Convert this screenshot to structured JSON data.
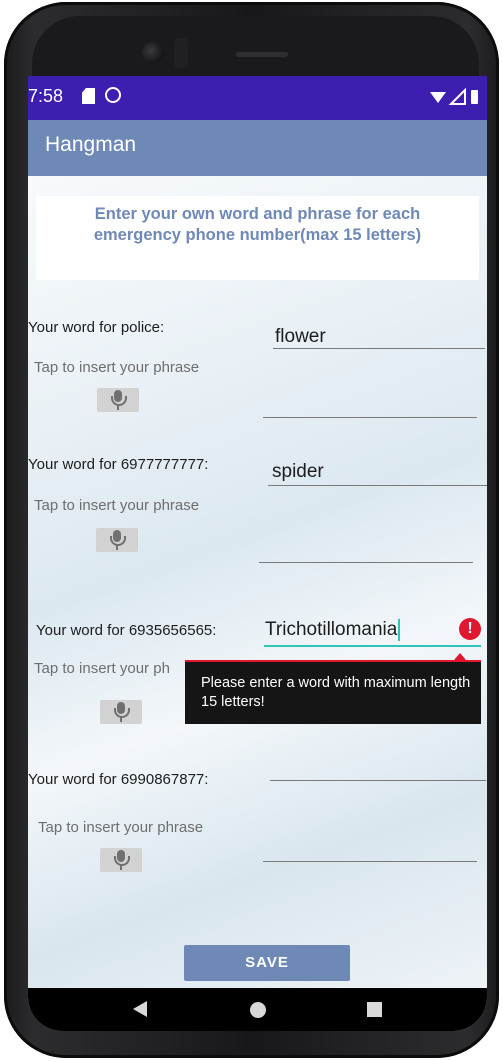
{
  "status_bar": {
    "time": "7:58",
    "icons": [
      "sim-card-icon",
      "sync-icon",
      "wifi-icon",
      "signal-icon",
      "battery-icon"
    ]
  },
  "app_bar": {
    "title": "Hangman"
  },
  "intro": {
    "text": "Enter your own word and phrase for each emergency phone number(max 15 letters)"
  },
  "entries": [
    {
      "word_label": "Your word for police:",
      "word_value": "flower",
      "phrase_hint": "Tap to insert your phrase",
      "phrase_value": ""
    },
    {
      "word_label": "Your word for 6977777777:",
      "word_value": "spider",
      "phrase_hint": "Tap to insert your phrase",
      "phrase_value": ""
    },
    {
      "word_label": "Your word for 6935656565:",
      "word_value": "Trichotillomania",
      "phrase_hint": "Tap to insert your ph",
      "phrase_value": ""
    },
    {
      "word_label": "Your word for 6990867877:",
      "word_value": "",
      "phrase_hint": "Tap to insert your phrase",
      "phrase_value": ""
    }
  ],
  "error": {
    "icon_text": "!",
    "message": "Please enter a word with maximum length 15 letters!"
  },
  "save_button": {
    "label": "SAVE"
  },
  "colors": {
    "accent": "#6f89b7",
    "status_bar": "#3c1fb0",
    "error": "#e0172f",
    "focus": "#2ec4b6"
  },
  "nav_bar": {
    "icons": [
      "back-icon",
      "home-icon",
      "recents-icon"
    ]
  }
}
